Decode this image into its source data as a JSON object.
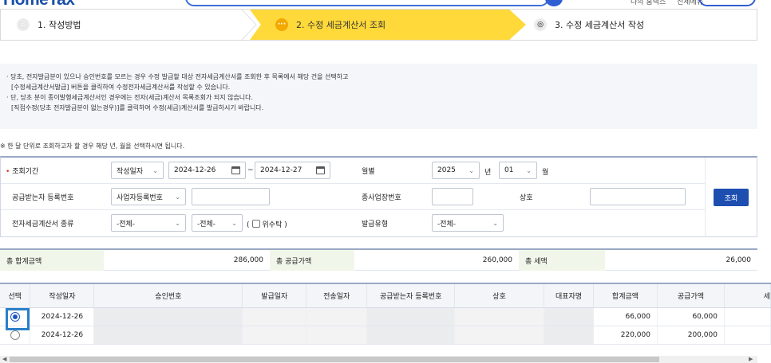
{
  "header": {
    "logo": "HomeTax",
    "links": [
      "나의 홈택스",
      "전체메뉴"
    ]
  },
  "steps": [
    {
      "num": "◎",
      "label": "1. 작성방법",
      "state": "done"
    },
    {
      "num": "···",
      "label": "2. 수정 세금계산서 조회",
      "state": "active"
    },
    {
      "num": "◎",
      "label": "3. 수정 세금계산서 작성",
      "state": "todo"
    }
  ],
  "notice": {
    "lines": [
      "· 당초, 전자발급분이 있으나 승인번호를 모르는 경우 수정 발급할 대상 전자세금계산서를 조회한 후 목록에서 해당 건을 선택하고",
      "  [수정세금계산서발급] 버튼을 클릭하여 수정전자세금계산서를 작성할 수 있습니다.",
      "· 단, 당초 분이 종이발행세금계산서인 경우에는 전자(세금)계산서 목록조회가 되지 않습니다.",
      "  [직접수정(당초 전자발급분이 없는경우)]를 클릭하여 수정(세금)계산서를 발급하시기 바랍니다."
    ]
  },
  "hint": "※ 한 달 단위로 조회하고자 할 경우 해당 년, 월을 선택하시면 됩니다.",
  "form": {
    "period_label": "조회기간",
    "period_required": "•",
    "date_type": "작성일자",
    "date_from": "2024-12-26",
    "tilde": "~",
    "date_to": "2024-12-27",
    "monthly_label": "월별",
    "year": "2025",
    "year_unit": "년",
    "month": "01",
    "month_unit": "월",
    "recipient_reg_label": "공급받는자 등록번호",
    "reg_type": "사업자등록번호",
    "reg_value": "",
    "branch_label": "종사업장번호",
    "branch_value": "",
    "company_label": "상호",
    "company_value": "",
    "doc_type_label": "전자세금계산서 종류",
    "doc_type1": "-전체-",
    "doc_type2": "-전체-",
    "consign_open": "(",
    "consign_label": "위수탁",
    "consign_close": ")",
    "issue_type_label": "발급유형",
    "issue_type": "-전체-",
    "search_button": "조회"
  },
  "totals": {
    "sum_label": "총 합계금액",
    "sum_value": "286,000",
    "supply_label": "총 공급가액",
    "supply_value": "260,000",
    "tax_label": "총 세액",
    "tax_value": "26,000"
  },
  "table": {
    "headers": [
      "선택",
      "작성일자",
      "승인번호",
      "발급일자",
      "전송일자",
      "공급받는자 등록번호",
      "상호",
      "대표자명",
      "합계금액",
      "공급가액",
      "세"
    ],
    "rows": [
      {
        "selected": true,
        "date": "2024-12-26",
        "total": "66,000",
        "supply": "60,000"
      },
      {
        "selected": false,
        "date": "2024-12-26",
        "total": "220,000",
        "supply": "200,000"
      }
    ]
  },
  "colors": {
    "accent": "#1e4fb0",
    "active_step": "#ffd93a",
    "highlight": "#2a7fc9"
  }
}
